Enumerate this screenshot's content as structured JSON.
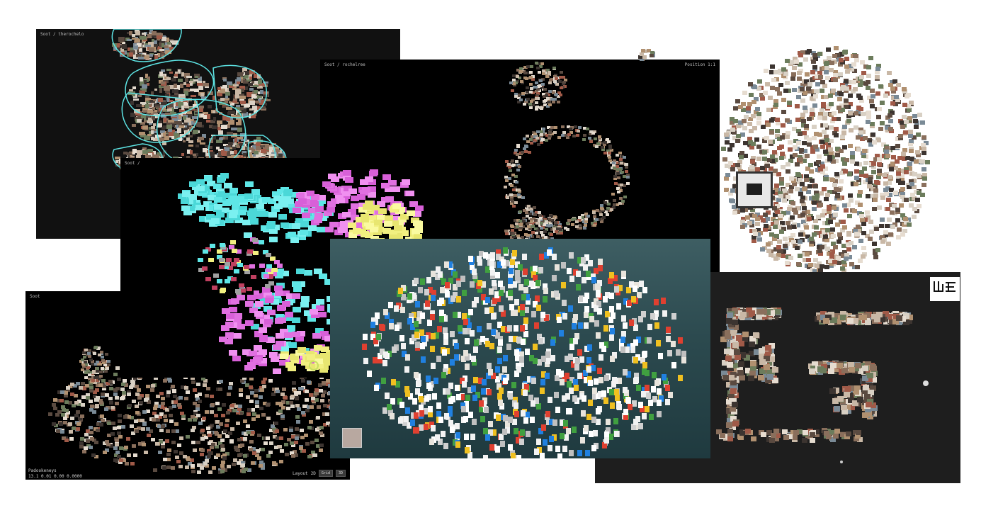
{
  "screens": {
    "top_left": {
      "breadcrumb": "Soot / therochelo"
    },
    "top_center": {
      "breadcrumb": "Soot / rochelree",
      "right_label": "Position 1:1"
    },
    "mid_left": {
      "breadcrumb": "Soot /"
    },
    "bottom_left": {
      "breadcrumb": "Soot",
      "footer_name": "Padookeneys",
      "footer_coords": "13.1 0.01 0.00 0.0000",
      "layout_label": "Layout",
      "layout_mode": "2D",
      "btn_a": "Grid",
      "btn_b": "3D"
    }
  },
  "colors": {
    "cyan": "#5ee6e6",
    "pink": "#e070e0",
    "yellow": "#f2f080",
    "ocean": "#2c4a4f",
    "dark_panel": "#1e1e1e",
    "black": "#000000"
  }
}
